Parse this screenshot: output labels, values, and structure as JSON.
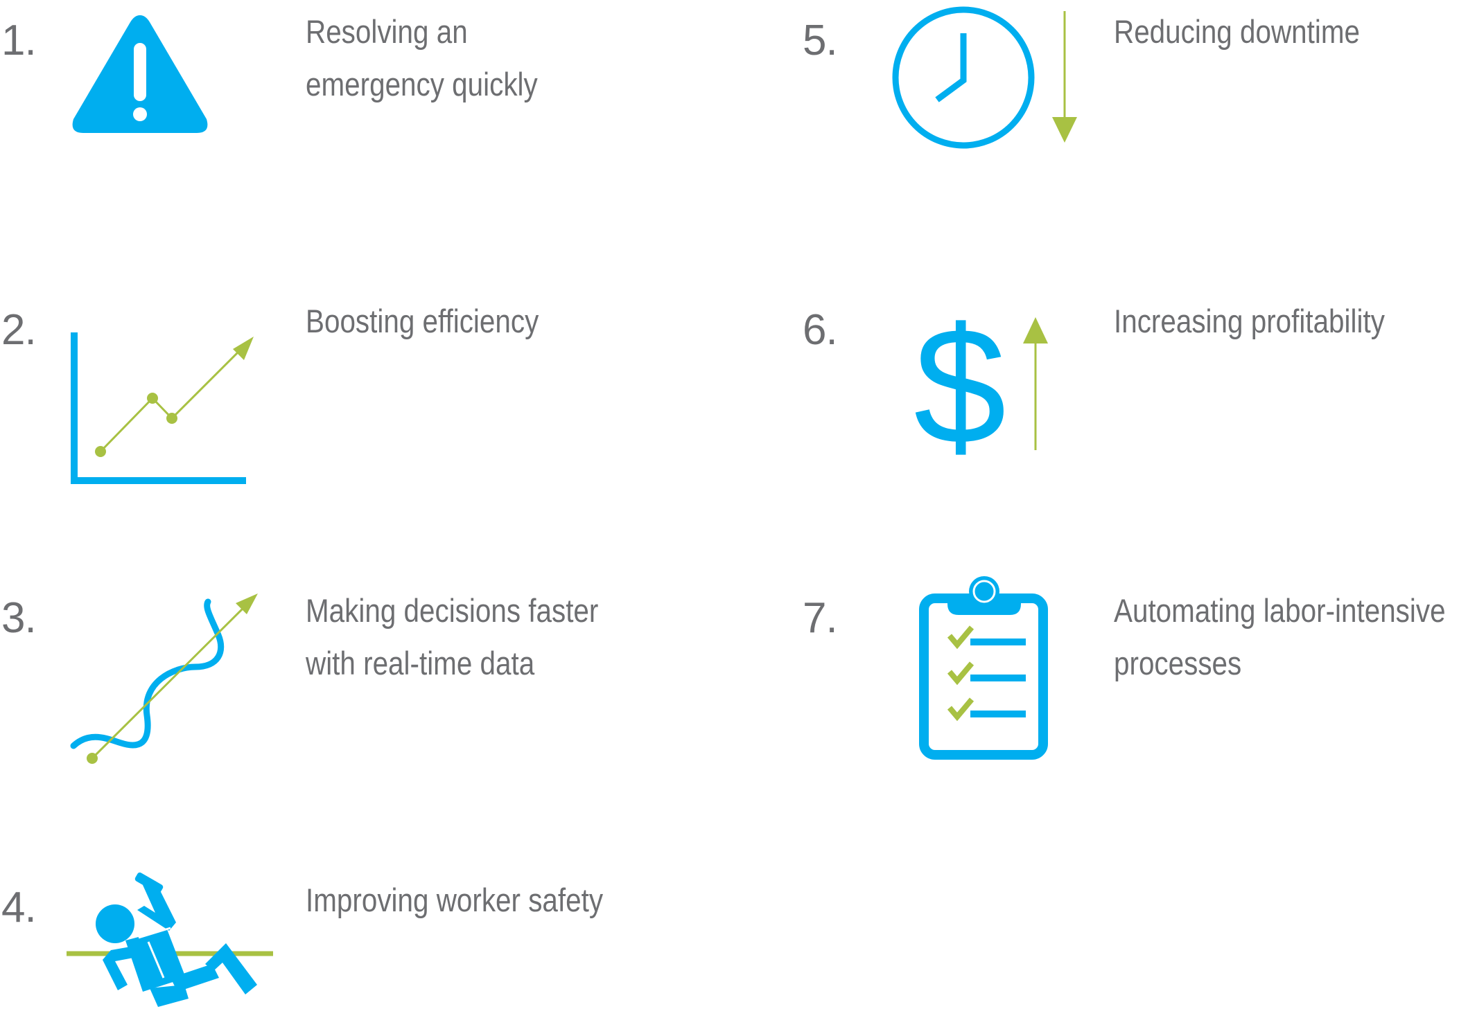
{
  "colors": {
    "blue": "#00aeef",
    "green": "#a8c143",
    "text": "#6d6e71",
    "background": "#ffffff"
  },
  "items": [
    {
      "number": "1.",
      "icon": "warning-triangle-icon",
      "lines": [
        "Resolving an",
        "emergency quickly"
      ]
    },
    {
      "number": "2.",
      "icon": "rising-line-chart-icon",
      "lines": [
        "Boosting efficiency"
      ]
    },
    {
      "number": "3.",
      "icon": "wave-with-trend-arrow-icon",
      "lines": [
        "Making decisions faster",
        "with real-time data"
      ]
    },
    {
      "number": "4.",
      "icon": "fallen-worker-icon",
      "lines": [
        "Improving worker safety"
      ]
    },
    {
      "number": "5.",
      "icon": "clock-with-down-arrow-icon",
      "lines": [
        "Reducing downtime"
      ]
    },
    {
      "number": "6.",
      "icon": "dollar-with-up-arrow-icon",
      "lines": [
        "Increasing profitability"
      ]
    },
    {
      "number": "7.",
      "icon": "checklist-clipboard-icon",
      "lines": [
        "Automating labor-intensive",
        "processes"
      ]
    }
  ]
}
